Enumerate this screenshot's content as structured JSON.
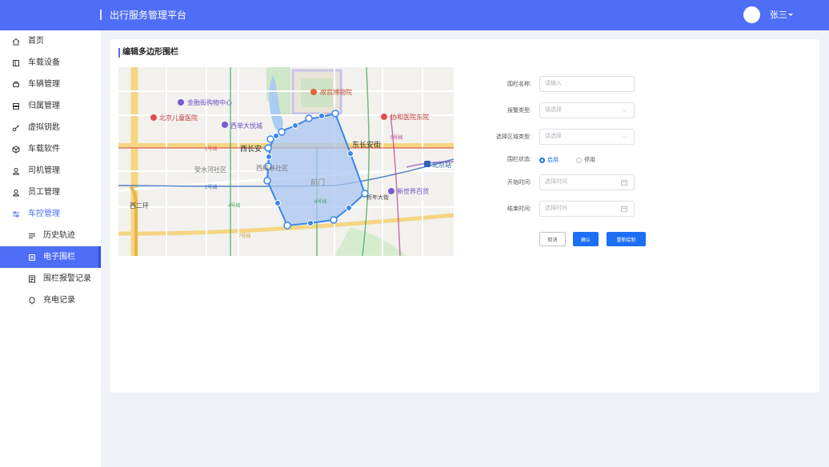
{
  "header": {
    "title": "出行服务管理平台",
    "username": "张三"
  },
  "sidebar": {
    "items": [
      {
        "label": "首页",
        "icon": "home-icon"
      },
      {
        "label": "车载设备",
        "icon": "device-icon"
      },
      {
        "label": "车辆管理",
        "icon": "car-icon"
      },
      {
        "label": "归属管理",
        "icon": "ownership-icon"
      },
      {
        "label": "虚拟钥匙",
        "icon": "key-icon"
      },
      {
        "label": "车载软件",
        "icon": "software-box-icon"
      },
      {
        "label": "司机管理",
        "icon": "driver-icon"
      },
      {
        "label": "员工管理",
        "icon": "staff-icon"
      },
      {
        "label": "车控管理",
        "icon": "control-icon"
      }
    ],
    "subitems": [
      {
        "label": "历史轨迹",
        "icon": "track-icon"
      },
      {
        "label": "电子围栏",
        "icon": "fence-icon"
      },
      {
        "label": "围栏报警记录",
        "icon": "alarm-record-icon"
      },
      {
        "label": "充电记录",
        "icon": "charge-icon"
      }
    ]
  },
  "card": {
    "title": "编辑多边形围栏"
  },
  "map": {
    "labels": {
      "jinrongjie": "金融街购物中心",
      "gugong": "故宫博物院",
      "ertong": "北京儿童医院",
      "xidan": "西单大悦城",
      "xiehe": "协和医院东院",
      "line1": "1号线",
      "xichangan": "西长安",
      "dongchangan": "东长安街",
      "shoushui": "受水河社区",
      "xirongxiang": "西絨巷社区",
      "qianmen": "前门",
      "line2": "2号线",
      "line4": "4号线",
      "line8": "8号线",
      "line5": "5号线",
      "qinian": "祈年大街",
      "xinshijie": "新世界百货",
      "beijingzhan": "北京站",
      "xierhuan": "西二环",
      "line7": "7号线"
    }
  },
  "form": {
    "name_label": "围栏名称:",
    "name_placeholder": "请输入",
    "alarm_label": "报警类型:",
    "alarm_placeholder": "请选择",
    "region_label": "选择区域类型:",
    "region_placeholder": "请选择",
    "status_label": "围栏状态:",
    "status_enabled": "启用",
    "status_disabled": "停用",
    "start_label": "开始时间:",
    "start_placeholder": "选择时间",
    "end_label": "结束时间:",
    "end_placeholder": "选择时间"
  },
  "buttons": {
    "cancel": "取消",
    "confirm": "确认",
    "redraw": "重新绘制"
  },
  "colors": {
    "accent": "#4f6ef7",
    "primary_button": "#1c6ef3",
    "polygon_fill": "#a9c6f2",
    "polygon_stroke": "#3a87ea"
  }
}
